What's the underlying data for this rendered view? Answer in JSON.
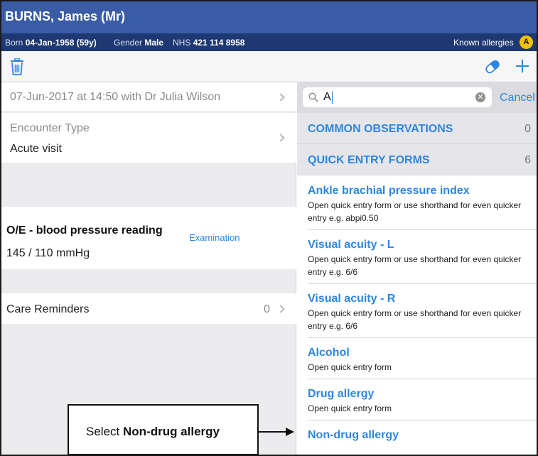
{
  "header": {
    "patient_name": "BURNS, James (Mr)",
    "born_label": "Born",
    "born_value": "04-Jan-1958 (59y)",
    "gender_label": "Gender",
    "gender_value": "Male",
    "nhs_label": "NHS",
    "nhs_value": "421 114 8958",
    "allergies_label": "Known allergies",
    "allergy_badge": "A"
  },
  "toolbar": {
    "delete_icon": "trash-icon",
    "medication_icon": "pill-icon",
    "add_icon": "plus-icon"
  },
  "left": {
    "consultation": "07-Jun-2017 at 14:50 with Dr Julia Wilson",
    "encounter_label": "Encounter Type",
    "encounter_value": "Acute visit",
    "observation_title": "O/E - blood pressure reading",
    "observation_value": "145 / 110 mmHg",
    "observation_tag": "Examination",
    "care_reminders_label": "Care Reminders",
    "care_reminders_count": "0"
  },
  "search": {
    "value": "A",
    "cancel_label": "Cancel"
  },
  "sections": [
    {
      "title": "COMMON OBSERVATIONS",
      "count": "0"
    },
    {
      "title": "QUICK ENTRY FORMS",
      "count": "6"
    }
  ],
  "entries": [
    {
      "title": "Ankle brachial pressure index",
      "desc": "Open quick entry form or use shorthand for even quicker entry e.g. abpi0.50"
    },
    {
      "title": "Visual acuity - L",
      "desc": "Open quick entry form or use shorthand for even quicker entry e.g. 6/6"
    },
    {
      "title": "Visual acuity - R",
      "desc": "Open quick entry form or use shorthand for even quicker entry e.g. 6/6"
    },
    {
      "title": "Alcohol",
      "desc": "Open quick entry form"
    },
    {
      "title": "Drug allergy",
      "desc": "Open quick entry form"
    },
    {
      "title": "Non-drug allergy",
      "desc": ""
    }
  ],
  "callout": {
    "prefix": "Select",
    "target": "Non-drug allergy"
  },
  "colors": {
    "title_bar": "#3a5ca6",
    "info_bar": "#1d3872",
    "accent": "#2e86de",
    "allergy_badge": "#f2c200"
  }
}
